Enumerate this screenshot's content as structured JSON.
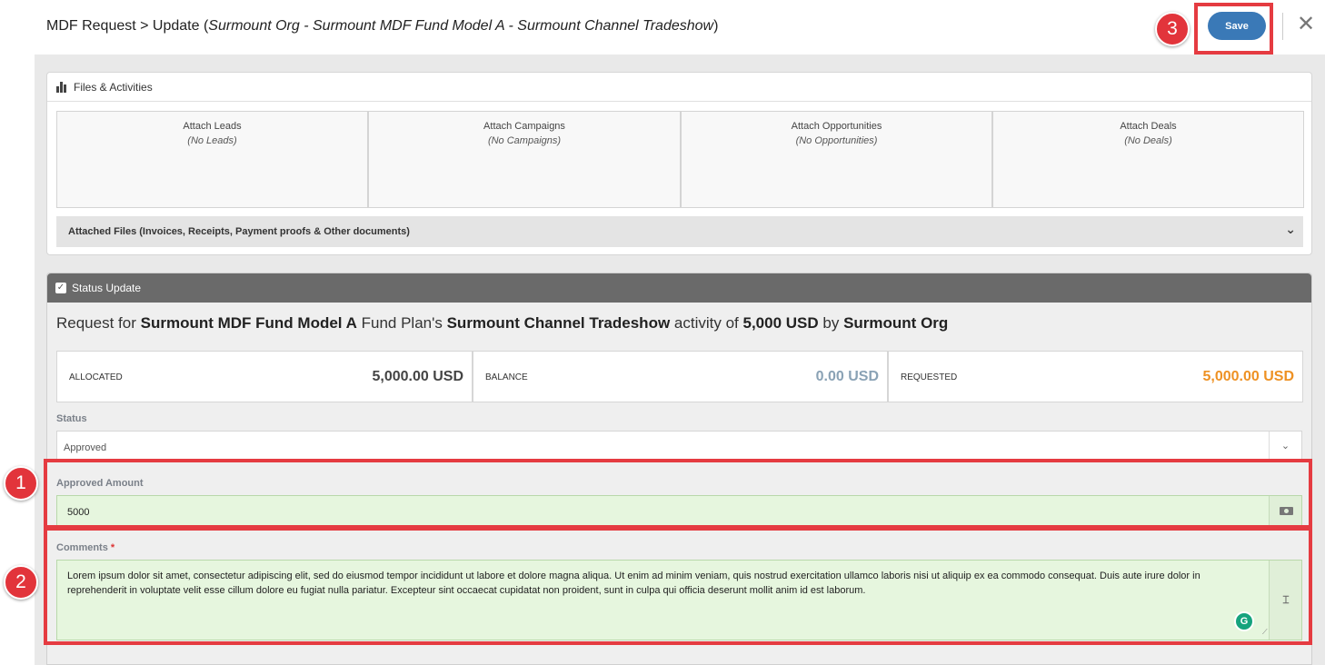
{
  "header": {
    "title_prefix": "MDF Request > Update (",
    "title_italic": "Surmount Org - Surmount MDF Fund Model A - Surmount Channel Tradeshow",
    "title_suffix": ")",
    "save_label": "Save",
    "close_glyph": "✕"
  },
  "files_panel": {
    "title": "Files & Activities",
    "attach": [
      {
        "label": "Attach Leads",
        "empty": "(No Leads)"
      },
      {
        "label": "Attach Campaigns",
        "empty": "(No Campaigns)"
      },
      {
        "label": "Attach Opportunities",
        "empty": "(No Opportunities)"
      },
      {
        "label": "Attach Deals",
        "empty": "(No Deals)"
      }
    ],
    "attached_files": "Attached Files (Invoices, Receipts, Payment proofs & Other documents)"
  },
  "status_panel": {
    "title": "Status Update",
    "request": {
      "t1": "Request for ",
      "fund": "Surmount MDF Fund Model A",
      "t2": " Fund Plan's ",
      "activity": "Surmount Channel Tradeshow",
      "t3": " activity of ",
      "amount": "5,000 USD",
      "t4": " by ",
      "org": "Surmount Org"
    },
    "stats": [
      {
        "key": "ALLOCATED",
        "value": "5,000.00 USD",
        "color": "#444444"
      },
      {
        "key": "BALANCE",
        "value": "0.00 USD",
        "color": "#8aa2b5"
      },
      {
        "key": "REQUESTED",
        "value": "5,000.00 USD",
        "color": "#ee9123"
      }
    ],
    "status_label": "Status",
    "status_value": "Approved",
    "approved_amount_label": "Approved Amount",
    "approved_amount_value": "5000",
    "comments_label": "Comments",
    "comments_required": "*",
    "comments_value": "Lorem ipsum dolor sit amet, consectetur adipiscing elit, sed do eiusmod tempor incididunt ut labore et dolore magna aliqua. Ut enim ad minim veniam, quis nostrud exercitation ullamco laboris nisi ut aliquip ex ea commodo consequat. Duis aute irure dolor in reprehenderit in voluptate velit esse cillum dolore eu fugiat nulla pariatur. Excepteur sint occaecat cupidatat non proident, sunt in culpa qui officia deserunt mollit anim id est laborum."
  },
  "annotations": [
    "1",
    "2",
    "3"
  ],
  "colors": {
    "accent": "#3a79b7",
    "highlight": "#e53b41",
    "success_bg": "#e6f6de"
  }
}
